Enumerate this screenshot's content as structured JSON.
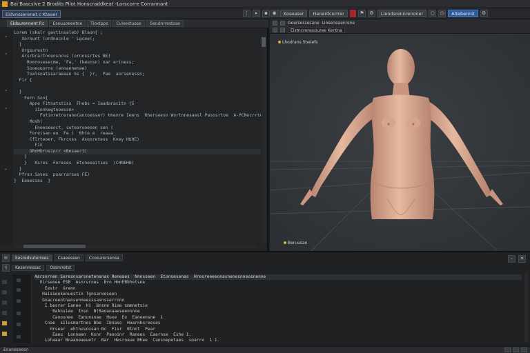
{
  "window": {
    "title": "Bai Bascsive 2 Brodits Pilot Honscraddkeat -Lorscorre Corrannant"
  },
  "toolbar": {
    "left_tabs": [
      {
        "label": "Eldvnsserenet c Kteaer"
      }
    ],
    "right_tabs": [
      {
        "label": "Koseaser"
      },
      {
        "label": "Hanerdcorrrer"
      },
      {
        "label": "Liendsrennrenoner"
      },
      {
        "label": "Altebennit"
      }
    ]
  },
  "editor": {
    "tabs": [
      {
        "label": "Eldsurennent P.c"
      },
      {
        "label": "Eseuuoeeetoe"
      },
      {
        "label": "Tioxtpps"
      },
      {
        "label": "Cvixestuose"
      },
      {
        "label": "Gendnrrestose"
      }
    ],
    "lines": [
      "Lorem (skalr gavtinsaleb) Blaon{ ;",
      "   Xornunt (ordnucnle ' Lgcee(;",
      "  }",
      "   Urgsurestn",
      "   Arsrbrartnoonsncus (ornnssrtes BE)",
      "     Roenosesecme, 'Fa,' (keunsn) nar eriness;",
      "     Sooeuuorns (enoannenae)",
      "     Toalsnatssaraeaan Ss {  }r,  Pae  aorsenessn;",
      "  Fir {",
      "",
      "  }",
      "    Fern Son{",
      "      Apne Fitnatstiss  Fhebs = Iaadaracitn {5",
      "        iInnkegtnoessn>",
      "          Fotinretrerane(ancoesser) Hnenre Ieens  Rherseesn Wortnnesaesl Pasosrtoe  A-PCNecrrtenet(3);",
      "      Mosh(",
      "        Eneeseeoct, sutearooesen sen (",
      "      Foreisan eo  Fe (  Bhte e  reaaa_",
      "      Cflrteoer, Fkrcvss  Asonretess  Kney HUHE)",
      "        Fin",
      "      GRoHUrnsinrr <Besaert)",
      "    }",
      "    }   Ksres  Foreses  Etoneeaitses  (CHNEHB)",
      "  }",
      "  Pfrsn Soves  pserrarses FE)",
      "}  Eaeesses  }"
    ]
  },
  "viewport": {
    "header_fields": [
      {
        "label": "Geersessesane"
      },
      {
        "label": "Lioseneaenrene"
      }
    ],
    "header_row2": [
      {
        "label": "Eistncrensuouree Kentna"
      }
    ],
    "tag": "Lhodrans Soeiefs",
    "corner_label": "Beruusan"
  },
  "bottom": {
    "tabs": [
      {
        "label": "Eesredsuterrees"
      },
      {
        "label": "Csaeessen"
      },
      {
        "label": "Ccosurersensa"
      }
    ],
    "bar2": [
      {
        "label": "Kesenressac"
      },
      {
        "label": "Ossnrretst"
      }
    ],
    "log_header": "Aarsnrnen Seresnsarsnetensnas Reneaes  Nnnsseen  Etonsesenas  Hresreeeeonasnenesnneosnenne",
    "log_lines": [
      "  Oirsenee ESB  Asnrvrnes  Bvn HmnEBbhetsne",
      "    Eestr  Grenn",
      "   Haisseekenuestin Tgnsareeseen",
      "   Gnacreentnansenneesssasnsserrnnn",
      "    I besrer Eanee  Hi  Bnsne Rime smmnetsie",
      "       Bahnsiee  Insn  B(Baoanaaeseennnne",
      "       Canosnee  Eanunsnae  Huxe  Eo  Eaneensne  1",
      "    Cnae  sIlosmurtnes Bbe  Ibnaso  Hoarnhsreeses",
      "      Hrsear  ehtnusnosan Bc  Fisr  Btnnt  Pear",
      "       Eaeu  Lonneen  Ksnr  Paooinr  Ranees  Eaernse  Eshe 1.",
      "    Lohaaar Bnaaneaeuetr  Bar  Hesrnaue Bhee  Cansnepetaes  soarre  1 1."
    ]
  },
  "status": {
    "left": "Eoaneseesn"
  },
  "colors": {
    "accent_blue": "#2c5a9a",
    "accent_red": "#a4262c",
    "skin": "#d9a88c"
  }
}
